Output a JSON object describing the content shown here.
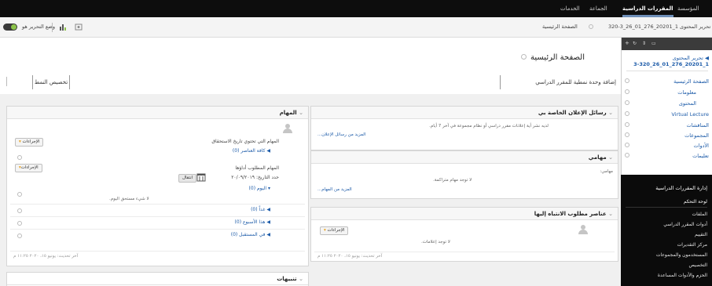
{
  "topbar": {
    "tabs": [
      {
        "label": "المؤسسة",
        "active": false
      },
      {
        "label": "المقررات الدراسية",
        "active": true
      },
      {
        "label": "الجماعة",
        "active": false
      },
      {
        "label": "الخدمات",
        "active": false
      }
    ]
  },
  "secbar": {
    "edit_mode": "تحرير المحتوى 1_20201_276_01_26_3-320",
    "home": "الصفحة الرئيسية",
    "user": "وضع التحرير هو"
  },
  "sidebar": {
    "course_title_line1": "تحرير المحتوى",
    "course_title_line2": "1_20201_276_01_26_3-320",
    "items": [
      {
        "label": "الصفحة الرئيسية"
      },
      {
        "label": "معلومات"
      },
      {
        "label": "المحتوى"
      },
      {
        "label": "Virtual Lecture"
      },
      {
        "label": "المناقشات"
      },
      {
        "label": "المجموعات"
      },
      {
        "label": "الأدوات"
      },
      {
        "label": "تعليمات"
      }
    ],
    "management_title": "إدارة المقررات الدراسية",
    "control_panel": "لوحة التحكم",
    "dark_items": [
      {
        "label": "الملفات"
      },
      {
        "label": "أدوات المقرر الدراسي"
      },
      {
        "label": "التقييم"
      },
      {
        "label": "مركز التقديرات"
      },
      {
        "label": "المستخدمون والمجموعات"
      },
      {
        "label": "التخصيص"
      },
      {
        "label": "الحزم والأدوات المساعدة"
      }
    ]
  },
  "main": {
    "page_title": "الصفحة الرئيسية",
    "add_module_button": "إضافة وحدة نمطية للمقرر الدراسي",
    "customize_button": "تخصيص النمط"
  },
  "panels": {
    "announcements": {
      "title": "رسائل الإعلان الخاصة بي",
      "message": "لديه نشر أية إعلانات مقرر دراسي أو نظام مجموعة في آخر 7 أيام.",
      "more_link": "المزيد من رسائل الإعلان..."
    },
    "my_tasks": {
      "title": "مهامي",
      "label": "مهامي:",
      "empty": "لا توجد مهام متراكمة.",
      "more_link": "المزيد من المهام..."
    },
    "needs_attention": {
      "title": "عناصر مطلوب الانتباه إليها",
      "actions": "الإجراءات",
      "empty": "لا توجد إعلامات.",
      "last_updated": "آخر تحديث: يونيو ١٥، ٢٠٢٠ ١١:٢٥ م"
    },
    "tasks": {
      "title": "المهام",
      "no_due_label": "المهام التي تحتوي تاريخ الاستحقاق",
      "actions": "الإجراءات",
      "all_items": "كافة العناصر",
      "all_items_count": "(0)",
      "done_label": "المهام المطلوب أداؤها",
      "actions2": "الإجراءات",
      "date_prefix": "حدد التاريخ:",
      "date_value": "٢٠/٠٩/٢٠١٩",
      "go_button": "انتقال",
      "today": "اليوم",
      "today_count": "(0)",
      "nothing_due": "لا شيء مستحق اليوم.",
      "tomorrow": "غداً",
      "tomorrow_count": "(0)",
      "this_week": "هذا الأسبوع",
      "this_week_count": "(0)",
      "future": "في المستقبل",
      "future_count": "(0)",
      "last_updated": "آخر تحديث: يونيو ١٥، ٢٠٢٠ ١١:٢٥ م"
    },
    "alerts": {
      "title": "تنبيهات"
    }
  },
  "colors": {
    "topbar_bg": "#0d0d0d",
    "link": "#1b5aa8",
    "accent": "#6e8fb8",
    "action_arrow": "#e8a019"
  }
}
